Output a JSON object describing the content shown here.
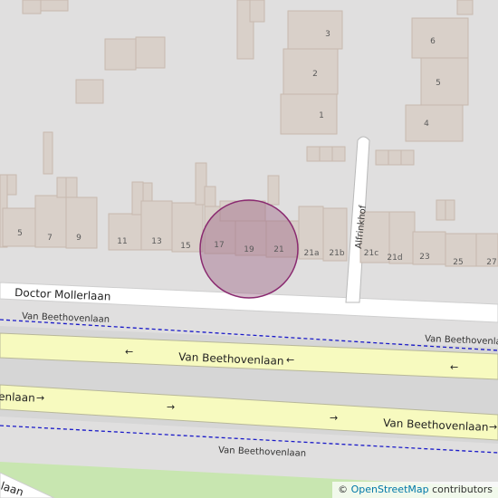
{
  "map": {
    "house_numbers": [
      "3",
      "2",
      "1",
      "6",
      "5",
      "4",
      "5",
      "7",
      "9",
      "11",
      "13",
      "15",
      "17",
      "19",
      "21",
      "21a",
      "21b",
      "21c",
      "21d",
      "23",
      "25",
      "27"
    ],
    "streets": {
      "doctor_mollerlaan": "Doctor Mollerlaan",
      "alfrinkhof": "Alfrinkhof",
      "van_beethovenlaan": "Van Beethovenlaan",
      "van_beethovenlaan_partial": "enlaan",
      "bottom_partial": "laan"
    },
    "marker": {
      "fill": "#a06a8a",
      "stroke": "#8a2a70"
    },
    "colors": {
      "background": "#e0dfdf",
      "building": "#d9d0c9",
      "road_white": "#ffffff",
      "road_yellow": "#f7fabf",
      "boundary_blue": "#1a1ac8",
      "park_green": "#c8e6b0"
    }
  },
  "attribution": {
    "prefix": "© ",
    "link": "OpenStreetMap",
    "suffix": " contributors"
  }
}
